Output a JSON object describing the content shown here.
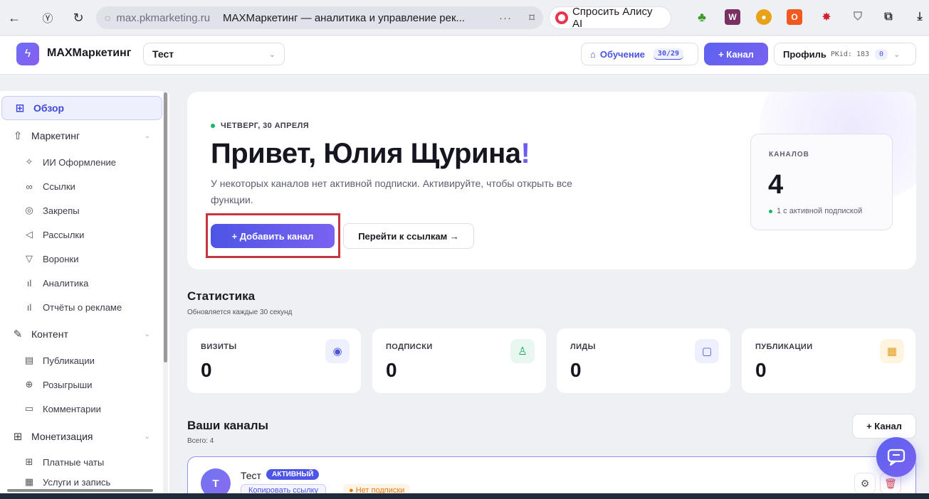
{
  "browser": {
    "domain": "max.pkmarketing.ru",
    "tab_title": "MAXМаркетинг — аналитика и управление рек...",
    "alice_label": "Спросить Алису AI"
  },
  "header": {
    "logo_text": "MAXМаркетинг",
    "project": "Тест",
    "learn_label": "Обучение",
    "learn_count": "30/29",
    "add_channel": "+ Канал",
    "profile_label": "Профиль",
    "pk_id": "PKid: 183",
    "pk_badge": "0"
  },
  "sidebar": {
    "items": [
      {
        "label": "Обзор",
        "icon": "grid-icon"
      },
      {
        "label": "Маркетинг",
        "icon": "upload-icon"
      },
      {
        "label": "ИИ Оформление",
        "icon": "magic-wand-icon"
      },
      {
        "label": "Ссылки",
        "icon": "link-icon"
      },
      {
        "label": "Закрепы",
        "icon": "pin-icon"
      },
      {
        "label": "Рассылки",
        "icon": "speaker-icon"
      },
      {
        "label": "Воронки",
        "icon": "funnel-icon"
      },
      {
        "label": "Аналитика",
        "icon": "bar-chart-icon"
      },
      {
        "label": "Отчёты о рекламе",
        "icon": "bar-chart-icon"
      },
      {
        "label": "Контент",
        "icon": "pen-icon"
      },
      {
        "label": "Публикации",
        "icon": "document-icon"
      },
      {
        "label": "Розыгрыши",
        "icon": "gift-icon"
      },
      {
        "label": "Комментарии",
        "icon": "comment-icon"
      },
      {
        "label": "Монетизация",
        "icon": "plus-box-icon"
      },
      {
        "label": "Платные чаты",
        "icon": "plus-box-icon"
      },
      {
        "label": "Услуги и запись",
        "icon": "calendar-icon"
      }
    ]
  },
  "hero": {
    "date": "ЧЕТВЕРГ, 30 АПРЕЛЯ",
    "greeting": "Привет, Юлия Щурина",
    "excl": "!",
    "description": "У некоторых каналов нет активной подписки. Активируйте, чтобы открыть все функции.",
    "add_channel": "+  Добавить канал",
    "goto_links": "Перейти к ссылкам →",
    "channels_label": "КАНАЛОВ",
    "channels_value": "4",
    "channels_note": "1 с активной подпиской"
  },
  "stats": {
    "title": "Статистика",
    "subtitle": "Обновляется каждые 30 секунд",
    "cards": [
      {
        "label": "ВИЗИТЫ",
        "value": "0",
        "icon": "eye-icon",
        "color": "#4a52e0",
        "bg": "#eef0fd"
      },
      {
        "label": "ПОДПИСКИ",
        "value": "0",
        "icon": "user-check-icon",
        "color": "#18a566",
        "bg": "#e8f7ef"
      },
      {
        "label": "ЛИДЫ",
        "value": "0",
        "icon": "chat-icon",
        "color": "#4a52e0",
        "bg": "#eef0fd"
      },
      {
        "label": "ПУБЛИКАЦИИ",
        "value": "0",
        "icon": "calendar-icon",
        "color": "#e59a1a",
        "bg": "#fff4e0"
      }
    ]
  },
  "channels": {
    "title": "Ваши каналы",
    "subtitle": "Всего: 4",
    "add": "+ Канал",
    "rows": [
      {
        "avatar": "Т",
        "name": "Тест",
        "status": "АКТИВНЫЙ",
        "copy": "Копировать ссылку",
        "subscription": "● Нет подписки"
      }
    ]
  }
}
